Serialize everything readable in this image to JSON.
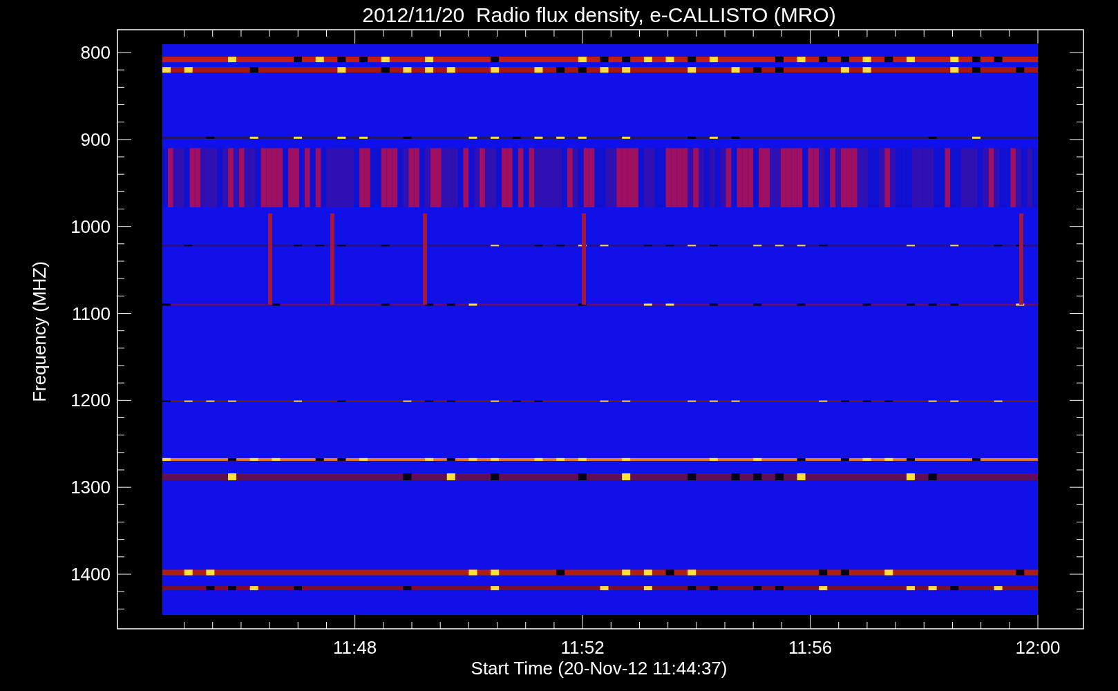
{
  "title": "2012/11/20  Radio flux density, e-CALLISTO (MRO)",
  "plot": {
    "ylabel": "Frequency (MHZ)",
    "xlabel": "Start Time (20-Nov-12 11:44:37)",
    "yticks": [
      "800",
      "900",
      "1000",
      "1100",
      "1200",
      "1300",
      "1400"
    ],
    "xticks": [
      "11:48",
      "11:52",
      "11:56",
      "12:00"
    ]
  }
}
